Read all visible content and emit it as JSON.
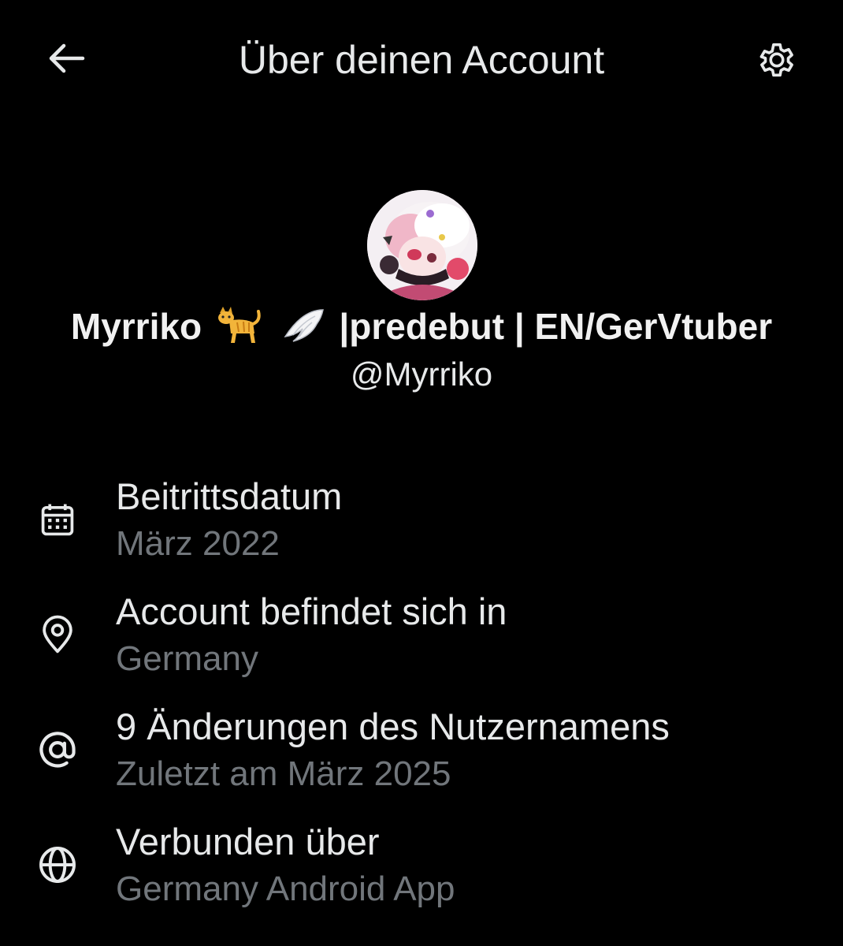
{
  "header": {
    "title": "Über deinen Account",
    "back_icon": "arrow-left-icon",
    "settings_icon": "gear-icon"
  },
  "profile": {
    "display_name_prefix": "Myrriko",
    "display_name_suffix": "|predebut | EN/GerVtuber",
    "name_emojis": [
      "cat-emoji",
      "wing-emoji"
    ],
    "handle": "@Myrriko",
    "avatar_icon": "anime-avatar-image"
  },
  "info": [
    {
      "icon": "calendar-icon",
      "title": "Beitrittsdatum",
      "subtitle": "März 2022"
    },
    {
      "icon": "location-pin-icon",
      "title": "Account befindet sich in",
      "subtitle": "Germany"
    },
    {
      "icon": "at-sign-icon",
      "title": "9 Änderungen des Nutzernamens",
      "subtitle": "Zuletzt am März 2025"
    },
    {
      "icon": "globe-icon",
      "title": "Verbunden über",
      "subtitle": "Germany Android App"
    }
  ],
  "colors": {
    "background": "#000000",
    "primary_text": "#e7e9ea",
    "secondary_text": "#71767b"
  }
}
